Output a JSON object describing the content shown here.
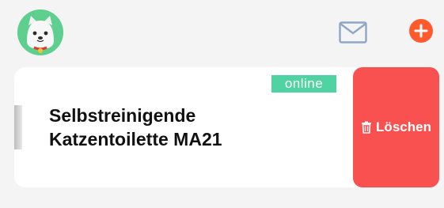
{
  "header": {
    "avatar_icon": "dog-avatar-icon",
    "mail_icon": "envelope-icon",
    "add_icon": "plus-icon",
    "colors": {
      "avatar_bg": "#5fcf8f",
      "add_button": "#ff5a2e",
      "mail_icon": "#8fa7c6"
    }
  },
  "device_card": {
    "status_badge": "online",
    "name": "Selbstreinigende Katzentoilette MA21",
    "colors": {
      "badge": "#4fd3a2"
    }
  },
  "swipe_action": {
    "delete_label": "Löschen",
    "delete_icon": "trash-icon",
    "colors": {
      "background": "#f85150"
    }
  }
}
